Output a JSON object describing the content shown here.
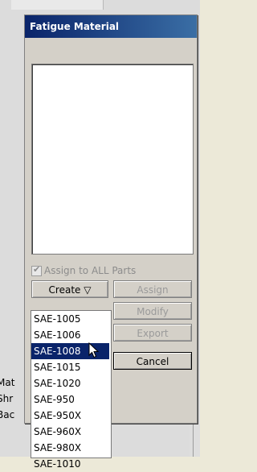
{
  "dialog": {
    "title": "Fatigue Material",
    "assign_all_label": "Assign to ALL Parts",
    "buttons": {
      "create": "Create",
      "assign": "Assign",
      "modify": "Modify",
      "export": "Export",
      "cancel": "Cancel"
    }
  },
  "dropdown": {
    "items": [
      "SAE-1005",
      "SAE-1006",
      "SAE-1008",
      "SAE-1015",
      "SAE-1020",
      "SAE-950",
      "SAE-950X",
      "SAE-960X",
      "SAE-980X",
      "SAE-1010"
    ],
    "selected": "SAE-1008"
  },
  "background": {
    "labels": [
      "Mat",
      "Shr",
      "Bac"
    ]
  },
  "colors": {
    "titlebar": "#0a246a",
    "selection": "#0a246a"
  }
}
